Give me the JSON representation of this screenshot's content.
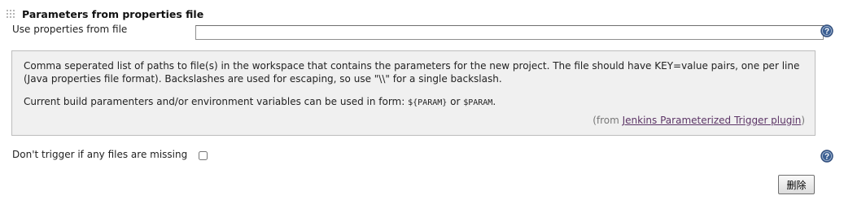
{
  "section": {
    "title": "Parameters from properties file"
  },
  "properties_file": {
    "label": "Use properties from file",
    "value": "",
    "help_icon": "help-circle-icon"
  },
  "help": {
    "paragraph1": "Comma seperated list of paths to file(s) in the workspace that contains the parameters for the new project. The file should have KEY=value pairs, one per line (Java properties file format). Backslashes are used for escaping, so use \"\\\\\" for a single backslash.",
    "paragraph2_prefix": "Current build paramenters and/or environment variables can be used in form: ",
    "param_braced": "${PARAM}",
    "or_text": " or ",
    "param_plain": "$PARAM",
    "period": ".",
    "from_prefix": "(from ",
    "plugin_link": "Jenkins Parameterized Trigger plugin",
    "from_suffix": ")"
  },
  "missing_files": {
    "label": "Don't trigger if any files are missing",
    "checked": false,
    "help_icon": "help-circle-icon"
  },
  "buttons": {
    "delete_label": "删除"
  },
  "colors": {
    "help_icon": "#3b5f93",
    "help_box_bg": "#f0f0f0",
    "link": "#5c3566"
  }
}
